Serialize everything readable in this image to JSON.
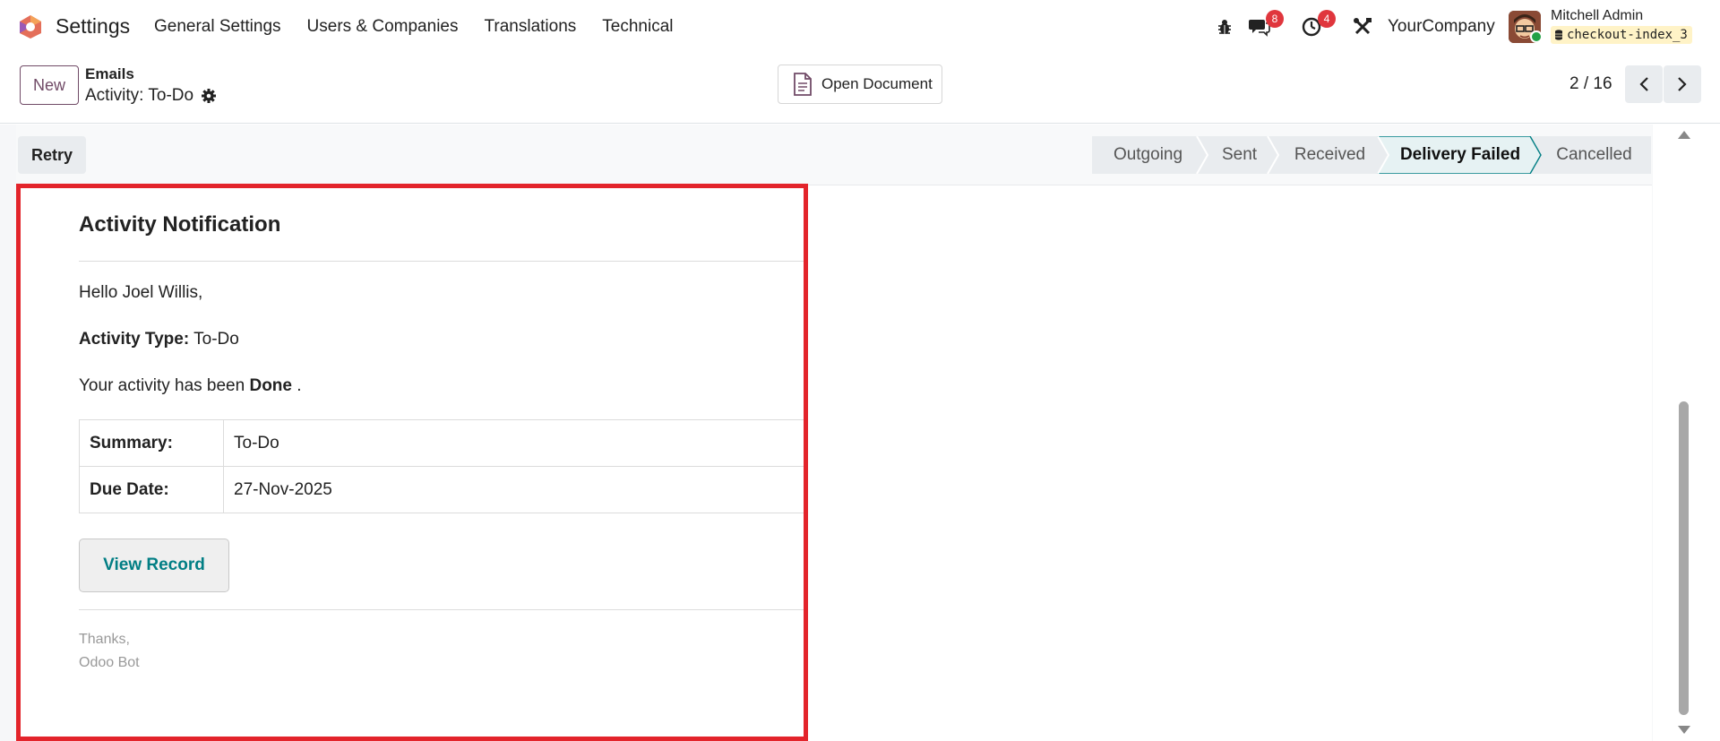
{
  "navbar": {
    "app_name": "Settings",
    "menu": [
      "General Settings",
      "Users & Companies",
      "Translations",
      "Technical"
    ],
    "chat_count": "8",
    "activity_count": "4",
    "company": "YourCompany",
    "user_name": "Mitchell Admin",
    "database": "checkout-index_3"
  },
  "control_panel": {
    "new_label": "New",
    "breadcrumb_parent": "Emails",
    "breadcrumb_current": "Activity: To-Do",
    "open_document_label": "Open Document",
    "pager": "2 / 16"
  },
  "statusbar": {
    "retry_label": "Retry",
    "stages": [
      {
        "label": "Outgoing",
        "active": false
      },
      {
        "label": "Sent",
        "active": false
      },
      {
        "label": "Received",
        "active": false
      },
      {
        "label": "Delivery Failed",
        "active": true
      },
      {
        "label": "Cancelled",
        "active": false
      }
    ]
  },
  "email": {
    "title": "Activity Notification",
    "greeting": "Hello Joel Willis,",
    "activity_type_label": "Activity Type:",
    "activity_type_value": "To-Do",
    "status_prefix": "Your activity has been",
    "status_value": "Done",
    "status_suffix": ".",
    "summary_label": "Summary:",
    "summary_value": "To-Do",
    "due_date_label": "Due Date:",
    "due_date_value": "27-Nov-2025",
    "view_record_label": "View Record",
    "signature_line1": "Thanks,",
    "signature_line2": "Odoo Bot"
  },
  "colors": {
    "brand": "#714b67",
    "accent_teal": "#017e84",
    "highlight_border": "#e3242b",
    "badge": "#e0363d"
  },
  "icons": [
    "odoo-logo-icon",
    "bug-icon",
    "chat-icon",
    "clock-icon",
    "tools-icon",
    "gear-icon",
    "document-icon",
    "chevron-left-icon",
    "chevron-right-icon",
    "database-icon"
  ]
}
